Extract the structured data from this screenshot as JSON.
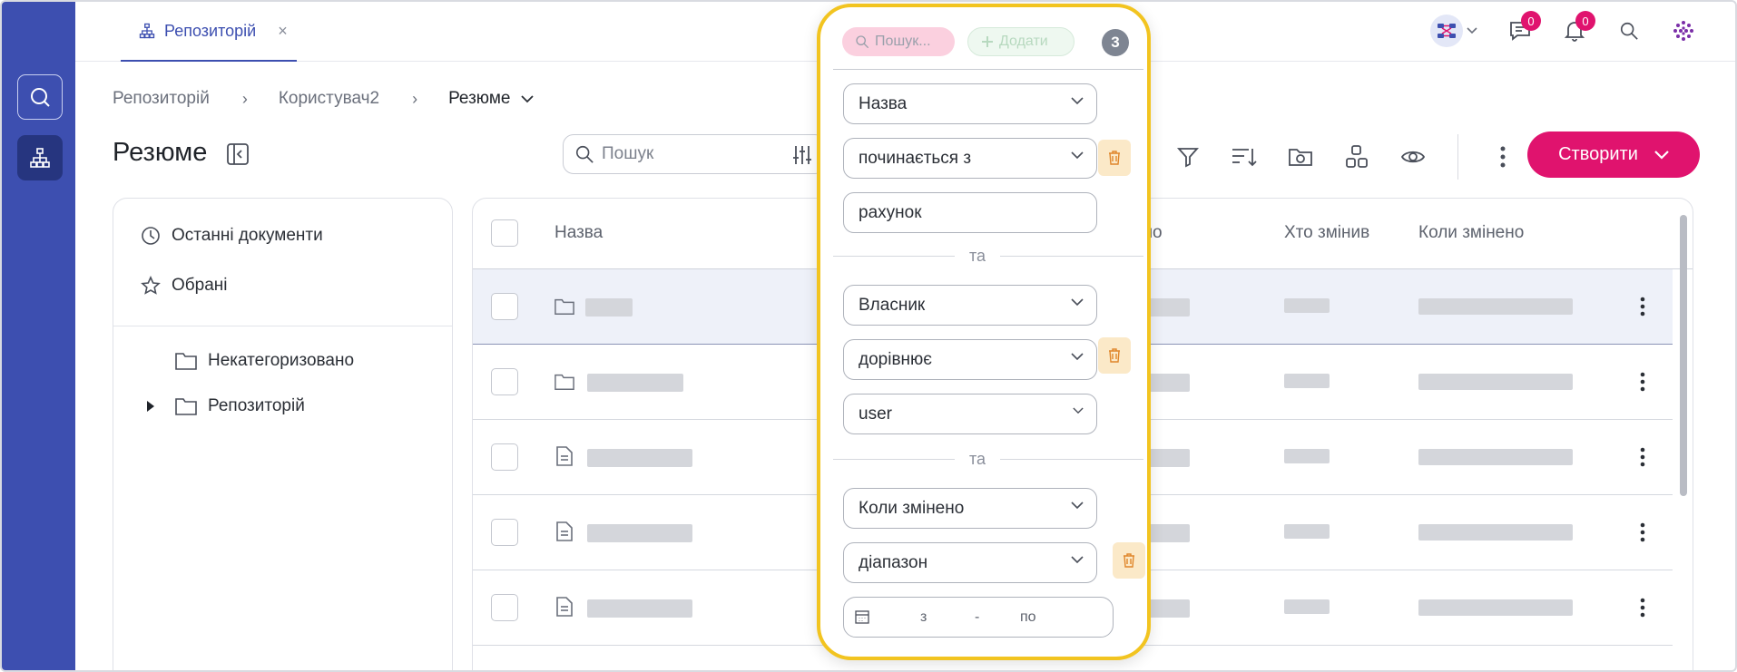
{
  "tab": {
    "label": "Репозиторій",
    "close": "×"
  },
  "notifications": {
    "messages_count": "0",
    "alerts_count": "0"
  },
  "breadcrumb": {
    "items": [
      "Репозиторій",
      "Користувач2",
      "Резюме"
    ],
    "separator": "›"
  },
  "page": {
    "title": "Резюме"
  },
  "search": {
    "placeholder": "Пошук"
  },
  "toolbar": {
    "create_label": "Створити"
  },
  "sidebar": {
    "recent": "Останні документи",
    "favorites": "Обрані",
    "folders": [
      "Некатегоризовано",
      "Репозиторій"
    ]
  },
  "table": {
    "columns": [
      "Назва",
      "ено",
      "Хто змінив",
      "Коли змінено"
    ],
    "rows": [
      {
        "type": "folder",
        "selected": true
      },
      {
        "type": "folder",
        "selected": false
      },
      {
        "type": "document",
        "selected": false
      },
      {
        "type": "document",
        "selected": false
      },
      {
        "type": "document",
        "selected": false
      }
    ]
  },
  "filter": {
    "search_chip": "Пошук...",
    "add_chip": "Додати",
    "count": "3",
    "groups": [
      {
        "field": "Назва",
        "operator": "починається з",
        "value": "рахунок"
      },
      {
        "field": "Власник",
        "operator": "дорівнює",
        "value": "user"
      },
      {
        "field": "Коли змінено",
        "operator": "діапазон",
        "from_label": "з",
        "dash": "-",
        "to_label": "по"
      }
    ],
    "conjunction": "та"
  },
  "colors": {
    "rail": "#3d4fb0",
    "accent": "#e0136e",
    "highlight": "#f2c420"
  },
  "icons": [
    "search-icon",
    "sitemap-icon",
    "chat-icon",
    "bell-icon",
    "apps-icon",
    "filter-icon",
    "sort-icon",
    "folder-icon",
    "document-icon",
    "eye-icon",
    "trash-icon",
    "calendar-icon"
  ]
}
